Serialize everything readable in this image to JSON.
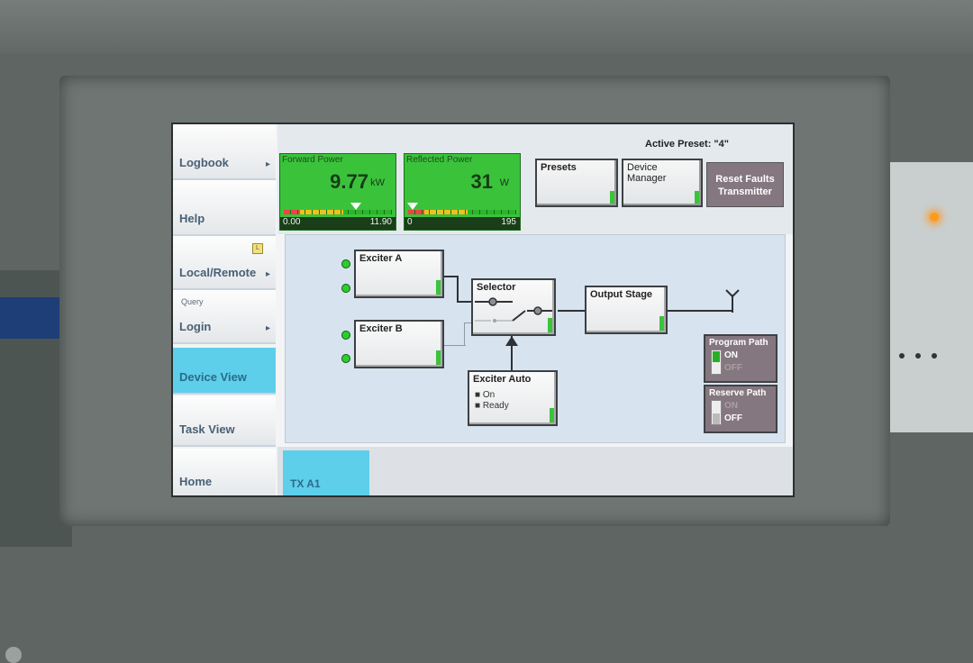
{
  "nav": {
    "logbook": "Logbook",
    "help": "Help",
    "local_remote": "Local/Remote",
    "local_badge": "L",
    "query": "Query",
    "login": "Login",
    "device_view": "Device View",
    "task_view": "Task View",
    "home": "Home"
  },
  "header": {
    "active_preset": "Active Preset: \"4\""
  },
  "forward_power": {
    "title": "Forward Power",
    "value": "9.77",
    "unit": "kW",
    "min": "0.00",
    "max": "11.90"
  },
  "reflected_power": {
    "title": "Reflected Power",
    "value": "31",
    "unit": "W",
    "min": "0",
    "max": "195"
  },
  "buttons": {
    "presets": "Presets",
    "device_manager": "Device Manager",
    "reset_faults_line1": "Reset Faults",
    "reset_faults_line2": "Transmitter"
  },
  "diagram": {
    "exciter_a": "Exciter A",
    "exciter_b": "Exciter B",
    "selector": "Selector",
    "output_stage": "Output Stage",
    "exciter_auto": "Exciter Auto",
    "exciter_auto_on": "On",
    "exciter_auto_ready": "Ready"
  },
  "program_path": {
    "title": "Program Path",
    "on": "ON",
    "off": "OFF",
    "state": "ON"
  },
  "reserve_path": {
    "title": "Reserve Path",
    "on": "ON",
    "off": "OFF",
    "state": "OFF"
  },
  "tabs": {
    "tx_a1": "TX A1"
  },
  "colors": {
    "accent_tab": "#5ecfea",
    "meter_green": "#3bc23b",
    "status_green": "#3ac43a",
    "reset_button": "#85777f"
  }
}
